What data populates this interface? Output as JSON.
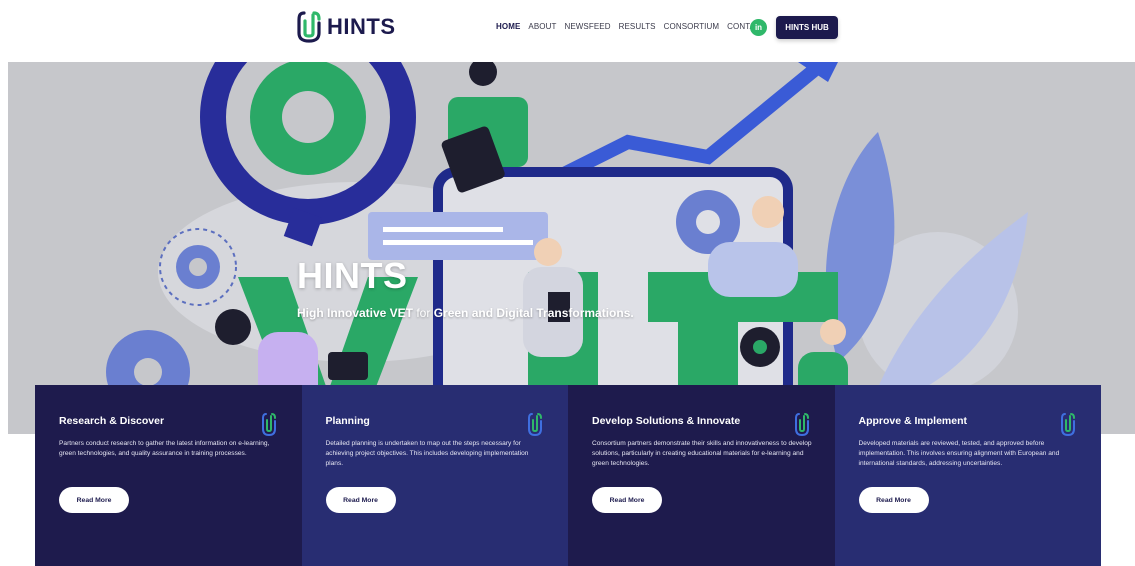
{
  "header": {
    "logo_text": "HINTS",
    "nav": [
      {
        "label": "HOME",
        "active": true
      },
      {
        "label": "ABOUT",
        "active": false
      },
      {
        "label": "NEWSFEED",
        "active": false
      },
      {
        "label": "RESULTS",
        "active": false
      },
      {
        "label": "CONSORTIUM",
        "active": false
      },
      {
        "label": "CONTACT",
        "active": false
      }
    ],
    "linkedin_label": "in",
    "hub_button": "HINTS HUB"
  },
  "hero": {
    "title": "HINTS",
    "subtitle_bold": "High Innovative VET",
    "subtitle_mid": " for ",
    "subtitle_rest": "Green and Digital Transformations."
  },
  "cards": [
    {
      "title": "Research & Discover",
      "text": "Partners conduct research to gather the latest information on e-learning, green technologies, and quality assurance in training processes.",
      "button": "Read More"
    },
    {
      "title": "Planning",
      "text": "Detailed planning is undertaken to map out the steps necessary for achieving project objectives. This includes developing implementation plans.",
      "button": "Read More"
    },
    {
      "title": "Develop Solutions & Innovate",
      "text": "Consortium partners demonstrate their skills and innovativeness to develop solutions, particularly in creating educational materials for e-learning and green technologies.",
      "button": "Read More"
    },
    {
      "title": "Approve & Implement",
      "text": "Developed materials are reviewed, tested, and approved before implementation. This involves ensuring alignment with European and international standards, addressing uncertainties.",
      "button": "Read More"
    }
  ],
  "colors": {
    "brand_dark": "#1c1a4d",
    "brand_blue": "#282d72",
    "brand_green": "#2fb86a",
    "hero_bg": "#c6c7cb"
  }
}
